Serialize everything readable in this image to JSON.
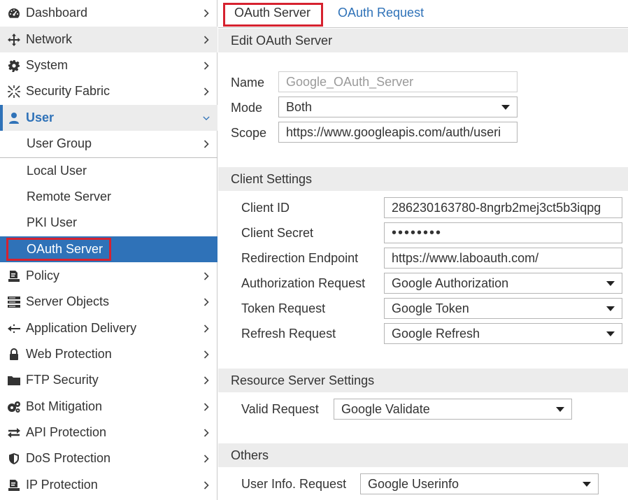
{
  "sidebar": {
    "items": [
      {
        "label": "Dashboard",
        "icon": "dashboard-icon"
      },
      {
        "label": "Network",
        "icon": "network-arrows-icon"
      },
      {
        "label": "System",
        "icon": "gear-icon"
      },
      {
        "label": "Security Fabric",
        "icon": "security-fabric-icon"
      },
      {
        "label": "User",
        "icon": "user-icon"
      },
      {
        "label": "User Group",
        "icon": ""
      },
      {
        "label": "Local User",
        "icon": ""
      },
      {
        "label": "Remote Server",
        "icon": ""
      },
      {
        "label": "PKI User",
        "icon": ""
      },
      {
        "label": "OAuth Server",
        "icon": ""
      },
      {
        "label": "Policy",
        "icon": "policy-icon"
      },
      {
        "label": "Server Objects",
        "icon": "server-objects-icon"
      },
      {
        "label": "Application Delivery",
        "icon": "application-delivery-icon"
      },
      {
        "label": "Web Protection",
        "icon": "lock-icon"
      },
      {
        "label": "FTP Security",
        "icon": "folder-icon"
      },
      {
        "label": "Bot Mitigation",
        "icon": "bot-mitigation-icon"
      },
      {
        "label": "API Protection",
        "icon": "api-arrows-icon"
      },
      {
        "label": "DoS Protection",
        "icon": "shield-icon"
      },
      {
        "label": "IP Protection",
        "icon": "ip-protection-icon"
      }
    ]
  },
  "tabs": [
    {
      "label": "OAuth Server"
    },
    {
      "label": "OAuth Request"
    }
  ],
  "edit": {
    "heading": "Edit OAuth Server",
    "name_label": "Name",
    "name_value": "Google_OAuth_Server",
    "mode_label": "Mode",
    "mode_value": "Both",
    "scope_label": "Scope",
    "scope_value": "https://www.googleapis.com/auth/useri"
  },
  "client": {
    "heading": "Client Settings",
    "client_id_label": "Client ID",
    "client_id_value": "286230163780-8ngrb2mej3ct5b3iqpg",
    "client_secret_label": "Client Secret",
    "client_secret_value": "••••••••",
    "redirect_label": "Redirection Endpoint",
    "redirect_value": "https://www.laboauth.com/",
    "auth_req_label": "Authorization Request",
    "auth_req_value": "Google Authorization",
    "token_req_label": "Token Request",
    "token_req_value": "Google Token",
    "refresh_req_label": "Refresh Request",
    "refresh_req_value": "Google Refresh"
  },
  "resource": {
    "heading": "Resource Server Settings",
    "valid_label": "Valid Request",
    "valid_value": "Google Validate"
  },
  "others": {
    "heading": "Others",
    "userinfo_label": "User Info. Request",
    "userinfo_value": "Google Userinfo"
  },
  "colors": {
    "accent": "#2f72b8",
    "highlight": "#d6222f",
    "section_bg": "#ececec"
  }
}
